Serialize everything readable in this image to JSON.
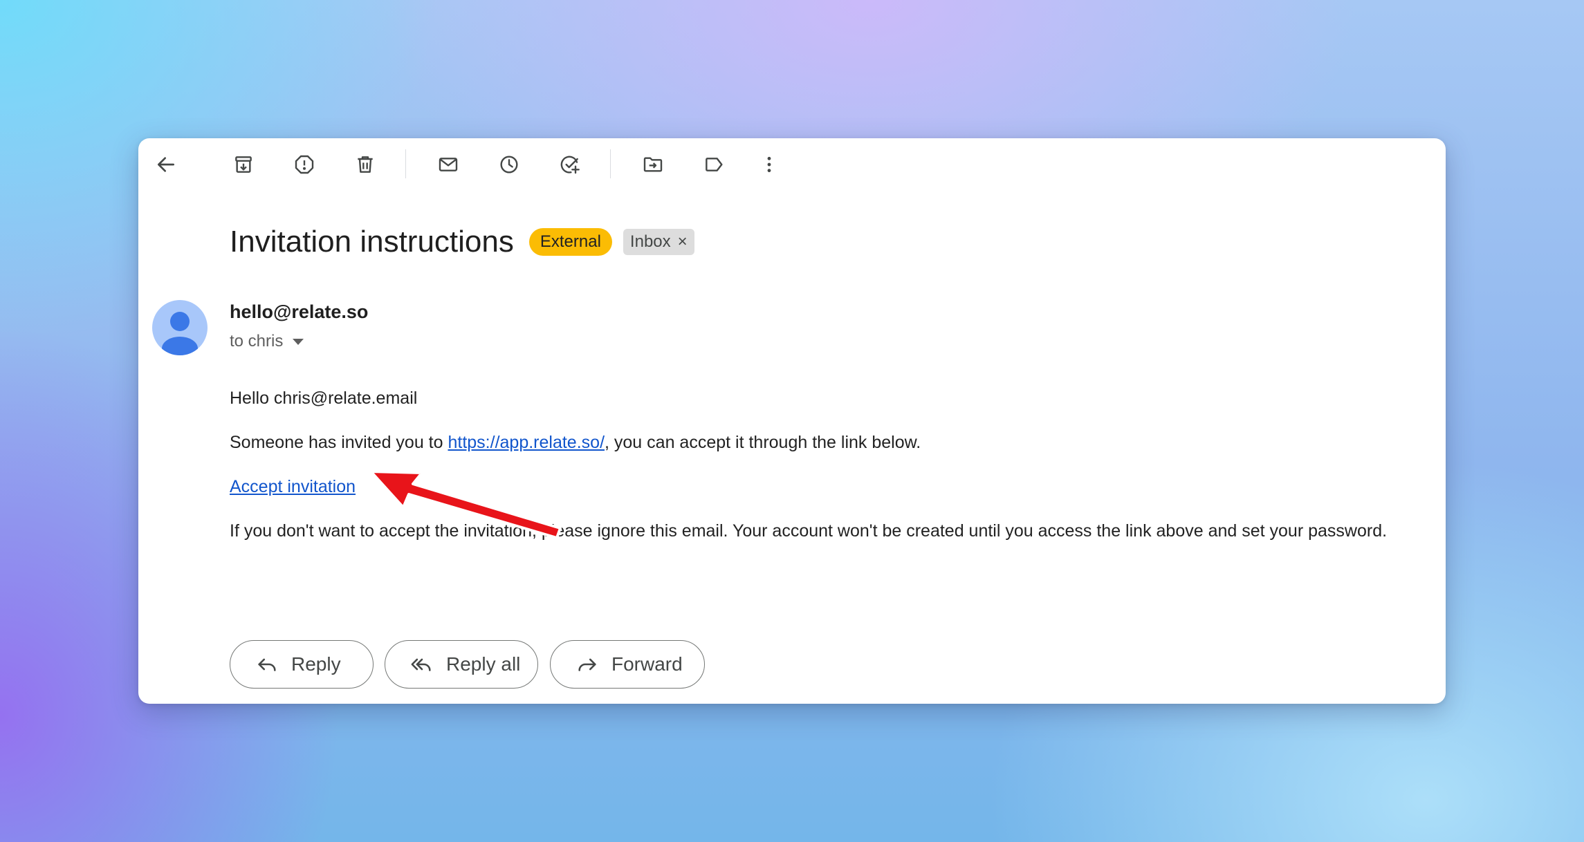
{
  "toolbar": {
    "back_icon": "arrow-left-icon",
    "items": [
      "archive-icon",
      "report-spam-icon",
      "delete-icon",
      "mark-unread-icon",
      "snooze-icon",
      "add-task-icon",
      "move-to-icon",
      "label-icon",
      "more-vert-icon"
    ]
  },
  "email": {
    "subject": "Invitation instructions",
    "labels": {
      "external": "External",
      "inbox": "Inbox",
      "inbox_remove": "×"
    },
    "sender": "hello@relate.so",
    "recipient": "to chris",
    "body": {
      "greeting": "Hello chris@relate.email",
      "line1_before": "Someone has invited you to ",
      "line1_link": "https://app.relate.so/",
      "line1_after": ", you can accept it through the link below.",
      "accept_link": "Accept invitation",
      "line3": "If you don't want to accept the invitation, please ignore this email. Your account won't be created until you access the link above and set your password."
    }
  },
  "actions": {
    "reply": "Reply",
    "reply_all": "Reply all",
    "forward": "Forward"
  },
  "colors": {
    "external_chip": "#fbbc04",
    "inbox_chip": "#dddddd",
    "link": "#1155cc",
    "annotation_arrow": "#e8141a",
    "avatar_bg": "#a8c7fa",
    "avatar_fg": "#3b78e7"
  }
}
